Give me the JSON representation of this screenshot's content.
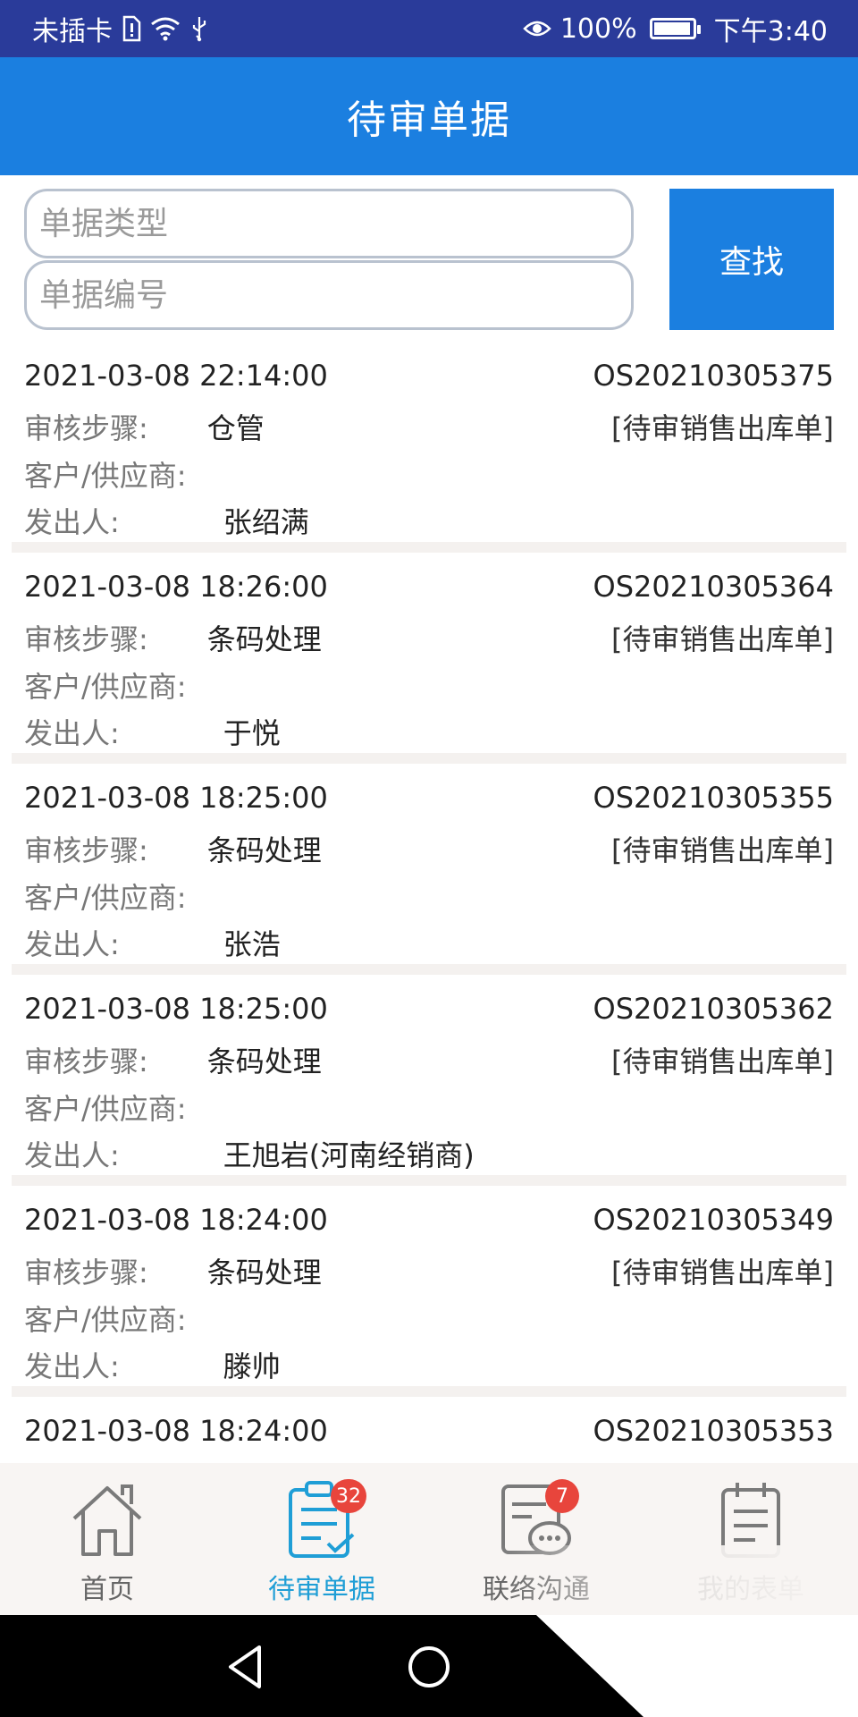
{
  "status_bar": {
    "carrier": "未插卡",
    "battery": "100%",
    "battery_level": 0.95,
    "time": "下午3:40"
  },
  "header": {
    "title": "待审单据"
  },
  "search": {
    "type_placeholder": "单据类型",
    "number_placeholder": "单据编号",
    "button_label": "查找"
  },
  "labels": {
    "step": "审核步骤:",
    "customer": "客户/供应商:",
    "sender": "发出人:"
  },
  "documents": [
    {
      "datetime": "2021-03-08 22:14:00",
      "doc_no": "OS20210305375",
      "step": "仓管",
      "doc_type": "[待审销售出库单]",
      "customer": "",
      "sender": "张绍满"
    },
    {
      "datetime": "2021-03-08 18:26:00",
      "doc_no": "OS20210305364",
      "step": "条码处理",
      "doc_type": "[待审销售出库单]",
      "customer": "",
      "sender": "于悦"
    },
    {
      "datetime": "2021-03-08 18:25:00",
      "doc_no": "OS20210305355",
      "step": "条码处理",
      "doc_type": "[待审销售出库单]",
      "customer": "",
      "sender": "张浩"
    },
    {
      "datetime": "2021-03-08 18:25:00",
      "doc_no": "OS20210305362",
      "step": "条码处理",
      "doc_type": "[待审销售出库单]",
      "customer": "",
      "sender": "王旭岩(河南经销商)"
    },
    {
      "datetime": "2021-03-08 18:24:00",
      "doc_no": "OS20210305349",
      "step": "条码处理",
      "doc_type": "[待审销售出库单]",
      "customer": "",
      "sender": "滕帅"
    },
    {
      "datetime": "2021-03-08 18:24:00",
      "doc_no": "OS20210305353",
      "step": "",
      "doc_type": "",
      "customer": "",
      "sender": ""
    }
  ],
  "bottom_nav": {
    "tabs": [
      {
        "label": "首页",
        "icon": "home-icon",
        "badge": ""
      },
      {
        "label": "待审单据",
        "icon": "clipboard-check-icon",
        "badge": "32"
      },
      {
        "label": "联络沟通",
        "icon": "message-icon",
        "badge": "7"
      },
      {
        "label": "我的表单",
        "icon": "form-icon",
        "badge": ""
      }
    ],
    "active_color": "#1f9ed6"
  },
  "colors": {
    "status_bar": "#2a3b9a",
    "header": "#1b7fe0",
    "badge": "#e8453c"
  }
}
